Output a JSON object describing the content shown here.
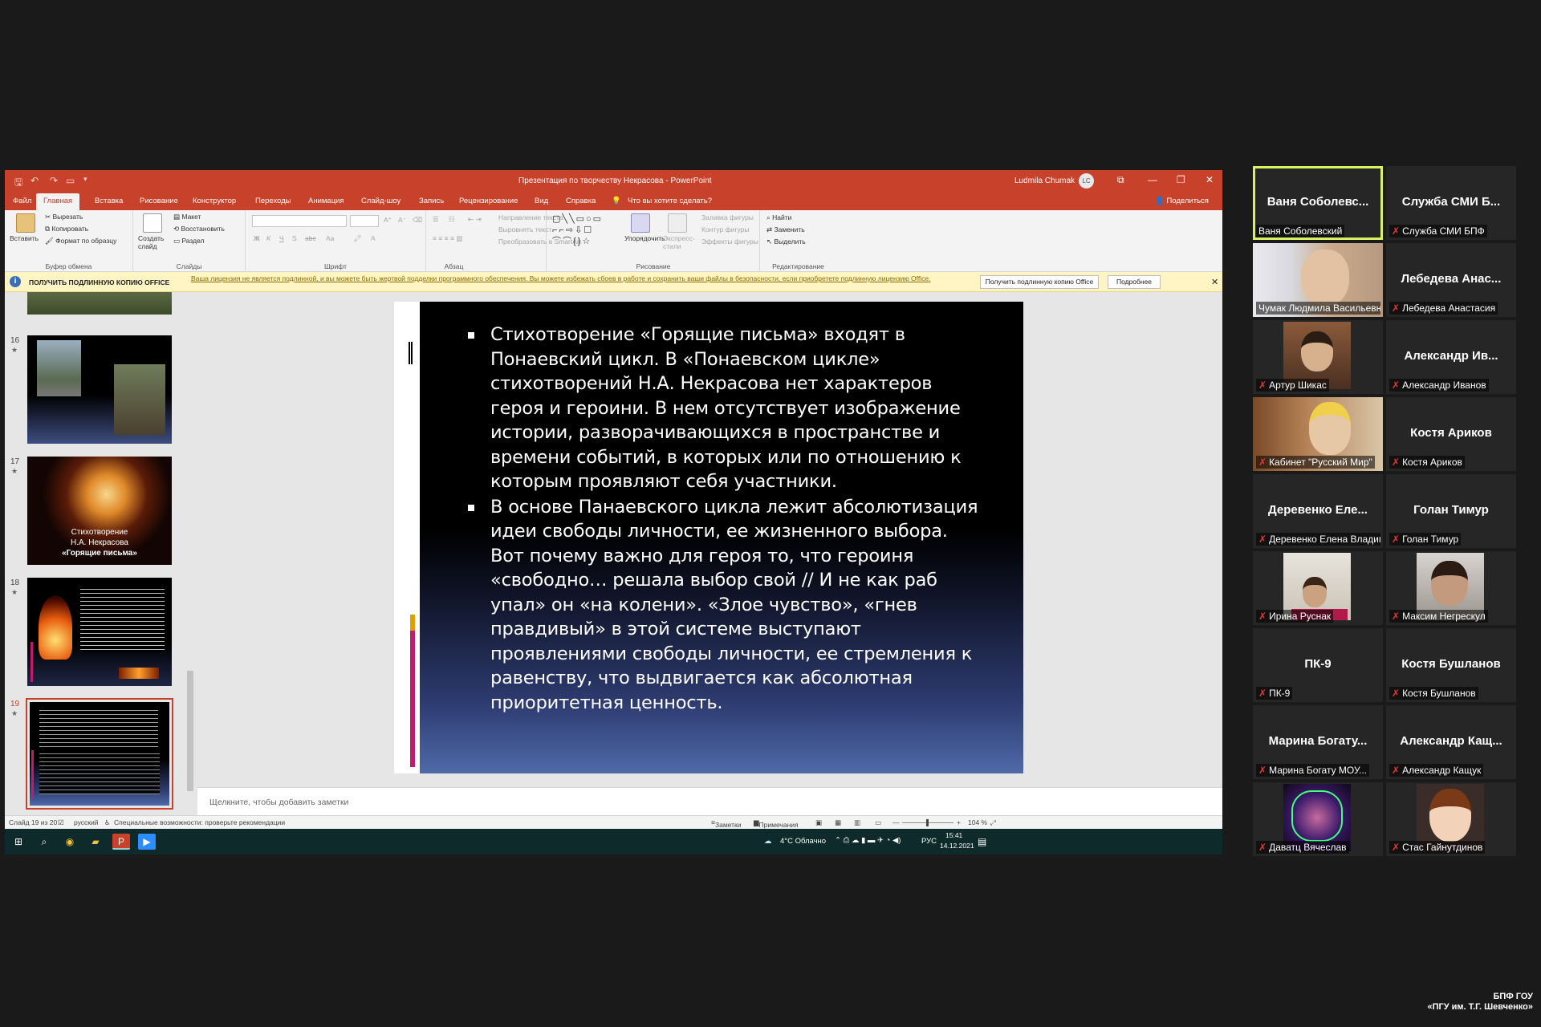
{
  "window": {
    "doc_title": "Презентация по творчеству Некрасова - PowerPoint",
    "user_name": "Ludmila Chumak",
    "user_initials": "LC"
  },
  "tabs": [
    "Файл",
    "Главная",
    "Вставка",
    "Рисование",
    "Конструктор",
    "Переходы",
    "Анимация",
    "Слайд-шоу",
    "Запись",
    "Рецензирование",
    "Вид",
    "Справка"
  ],
  "tell_me": "Что вы хотите сделать?",
  "share_label": "Поделиться",
  "ribbon": {
    "clipboard": {
      "paste": "Вставить",
      "cut": "Вырезать",
      "copy": "Копировать",
      "format_painter": "Формат по образцу",
      "label": "Буфер обмена"
    },
    "slides": {
      "new_slide": "Создать слайд",
      "layout": "Макет",
      "reset": "Восстановить",
      "section": "Раздел",
      "label": "Слайды"
    },
    "font": {
      "label": "Шрифт",
      "bold": "Ж",
      "italic": "К",
      "underline": "Ч",
      "strike": "S",
      "spacing": "abc",
      "case": "Aa"
    },
    "paragraph": {
      "text_direction": "Направление текста",
      "align_text": "Выровнять текст",
      "smartart": "Преобразовать в SmartArt",
      "label": "Абзац"
    },
    "drawing": {
      "arrange": "Упорядочить",
      "quick_styles": "Экспресс-стили",
      "fill": "Заливка фигуры",
      "outline": "Контур фигуры",
      "effects": "Эффекты фигуры",
      "label": "Рисование"
    },
    "editing": {
      "find": "Найти",
      "replace": "Заменить",
      "select": "Выделить",
      "label": "Редактирование"
    }
  },
  "infobar": {
    "title": "ПОЛУЧИТЬ ПОДЛИННУЮ КОПИЮ OFFICE",
    "message": "Ваша лицензия не является подлинной, и вы можете быть жертвой подделки программного обеспечения. Вы можете избежать сбоев в работе и сохранить ваши файлы в безопасности, если приобретете подлинную лицензию Office.",
    "btn_get": "Получить подлинную копию Office",
    "btn_more": "Подробнее"
  },
  "thumbnails": [
    {
      "num": "16",
      "star": "★"
    },
    {
      "num": "17",
      "star": "★",
      "line1": "Стихотворение",
      "line2": "Н.А. Некрасова",
      "line3": "«Горящие письма»"
    },
    {
      "num": "18",
      "star": "★"
    },
    {
      "num": "19",
      "star": "★"
    }
  ],
  "slide": {
    "bullet1": "Стихотворение «Горящие письма» входят в Понаевский цикл. В «Понаевском цикле» стихотворений Н.А. Некрасова нет характеров героя и героини. В нем отсутствует изображение истории, разворачивающихся в пространстве и времени событий, в которых или по отношению к которым проявляют себя участники.",
    "bullet2": "В основе Панаевского цикла лежит абсолютизация идеи свободы личности, ее жизненного выбора. Вот почему важно для героя то, что героиня «свободно… решала выбор свой // И не как раб упал» он «на колени». «Злое чувство», «гнев правдивый» в этой системе выступают проявлениями свободы личности, ее стремления к равенству, что выдвигается как абсолютная приоритетная ценность."
  },
  "notes_placeholder": "Щелкните, чтобы добавить заметки",
  "status": {
    "slide": "Слайд 19 из 20",
    "lang": "русский",
    "accessibility": "Специальные возможности: проверьте рекомендации",
    "notes": "Заметки",
    "comments": "Примечания",
    "zoom": "104 %"
  },
  "taskbar": {
    "weather": "4°C  Облачно",
    "lang": "РУС",
    "time": "15:41",
    "date": "14.12.2021"
  },
  "participants": [
    {
      "name": "Ваня Соболевс...",
      "label": "Ваня Соболевский",
      "muted": false,
      "active": true
    },
    {
      "name": "Служба СМИ Б...",
      "label": "Служба СМИ БПФ",
      "muted": true
    },
    {
      "name": "",
      "label": "Чумак Людмила Васильевна",
      "muted": false,
      "video": "person-blonde"
    },
    {
      "name": "Лебедева Анас...",
      "label": "Лебедева Анастасия",
      "muted": true
    },
    {
      "name": "",
      "label": "Артур Шикас",
      "muted": true,
      "video": "person-boy"
    },
    {
      "name": "Александр Ив...",
      "label": "Александр Иванов",
      "muted": true
    },
    {
      "name": "",
      "label": "Кабинет \"Русский Мир\"",
      "muted": true,
      "video": "person-glasses"
    },
    {
      "name": "Костя Ариков",
      "label": "Костя Ариков",
      "muted": true
    },
    {
      "name": "Деревенко Еле...",
      "label": "Деревенко Елена Владимировна",
      "muted": true
    },
    {
      "name": "Голан Тимур",
      "label": "Голан Тимур",
      "muted": true
    },
    {
      "name": "",
      "label": "Ирина Руснак",
      "muted": true,
      "video": "person-woman"
    },
    {
      "name": "",
      "label": "Максим Негрескул",
      "muted": true,
      "video": "person-dark"
    },
    {
      "name": "ПК-9",
      "label": "ПК-9",
      "muted": true
    },
    {
      "name": "Костя Бушланов",
      "label": "Костя Бушланов",
      "muted": true
    },
    {
      "name": "Марина Богату...",
      "label": "Марина Богату МОУ...",
      "muted": true
    },
    {
      "name": "Александр Кащ...",
      "label": "Александр Кащук",
      "muted": true
    },
    {
      "name": "",
      "label": "Даватц Вячеслав",
      "muted": true,
      "video": "avatar-neon"
    },
    {
      "name": "",
      "label": "Стас Гайнутдинов",
      "muted": true,
      "video": "avatar-anime"
    }
  ],
  "watermark": {
    "line1": "БПФ ГОУ",
    "line2": "«ПГУ им. Т.Г. Шевченко»"
  },
  "colors": {
    "ppt_red": "#c8412b",
    "active_speaker": "#d6f263",
    "muted_mic": "#e03a3a"
  }
}
